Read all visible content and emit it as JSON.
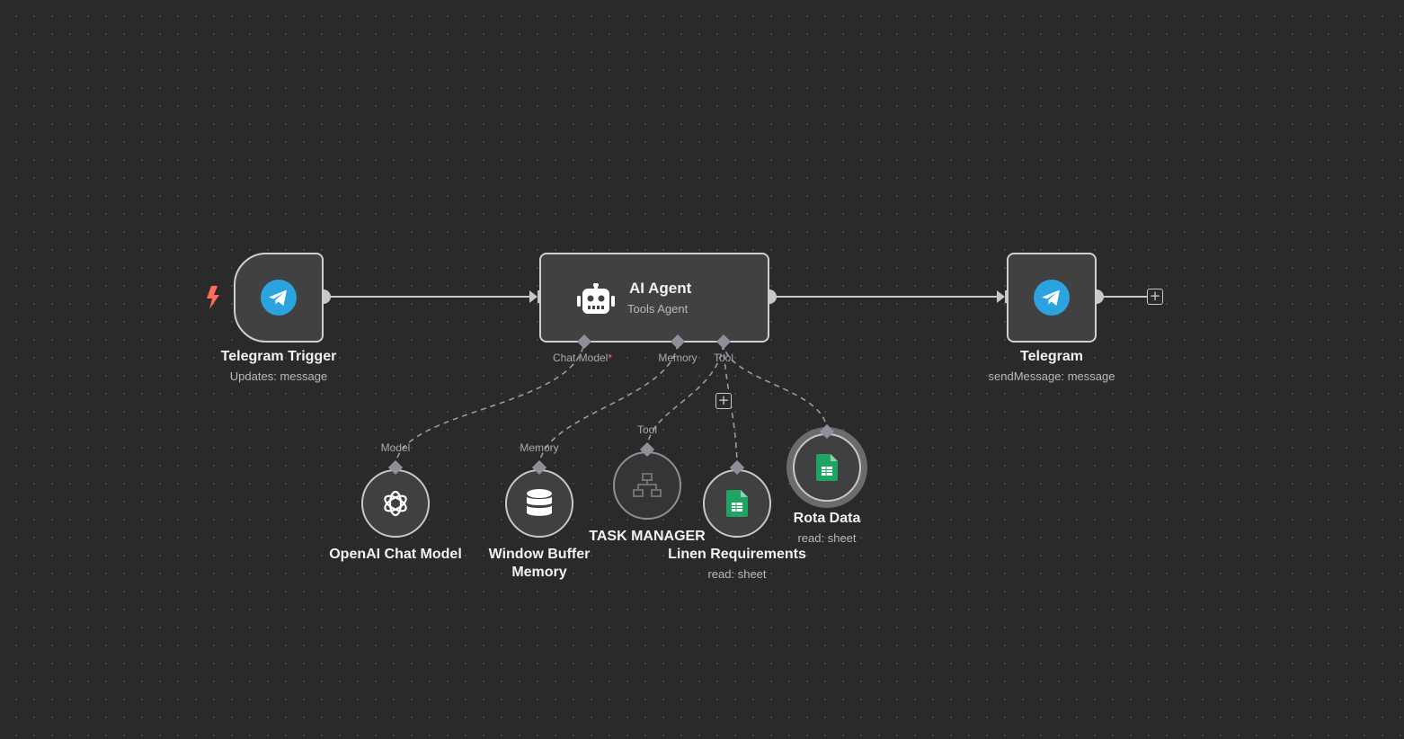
{
  "colors": {
    "canvas_bg": "#2a2a2a",
    "node_bg": "#414141",
    "node_border": "#cfcfd4",
    "connector": "#c8c8cc",
    "trigger_bolt": "#ff6d5a",
    "required_star": "#ff6d5a",
    "telegram_blue": "#2aa3df",
    "sheets_green": "#1fa463"
  },
  "nodes": {
    "telegram_trigger": {
      "title": "Telegram Trigger",
      "subtitle": "Updates: message",
      "icon": "telegram-icon",
      "badge_icon": "lightning-bolt-icon"
    },
    "ai_agent": {
      "title": "AI Agent",
      "subtitle": "Tools Agent",
      "icon": "robot-icon"
    },
    "telegram": {
      "title": "Telegram",
      "subtitle": "sendMessage: message",
      "icon": "telegram-icon"
    },
    "openai_chat_model": {
      "title": "OpenAI Chat Model",
      "icon": "openai-icon"
    },
    "window_buffer_memory": {
      "title": "Window Buffer Memory",
      "icon": "database-icon"
    },
    "task_manager": {
      "title": "TASK MANAGER",
      "icon": "network-icon"
    },
    "linen_requirements": {
      "title": "Linen Requirements",
      "subtitle": "read: sheet",
      "icon": "google-sheets-icon"
    },
    "rota_data": {
      "title": "Rota Data",
      "subtitle": "read: sheet",
      "icon": "google-sheets-icon"
    }
  },
  "ports": {
    "agent_chat_model": "Chat Model",
    "agent_chat_model_required": "*",
    "agent_memory": "Memory",
    "agent_tool": "Tool",
    "openai_model": "Model",
    "memory_in": "Memory",
    "task_manager_tool": "Tool"
  },
  "buttons": {
    "add_after_telegram": "+",
    "add_tool": "+"
  }
}
